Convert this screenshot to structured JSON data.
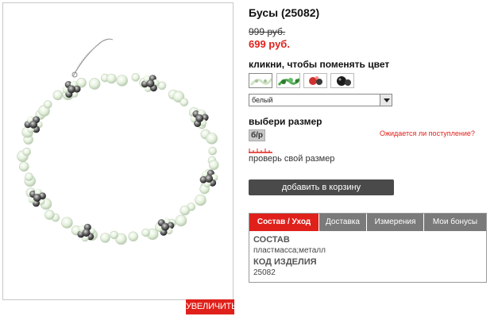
{
  "product": {
    "title": "Бусы (25082)",
    "old_price": "999 руб.",
    "new_price": "699 руб."
  },
  "gallery": {
    "zoom_label": "увеличить"
  },
  "color": {
    "heading": "кликни, чтобы поменять цвет",
    "swatches": [
      {
        "name": "white",
        "icon": "white-beads-swatch"
      },
      {
        "name": "green",
        "icon": "green-beads-swatch"
      },
      {
        "name": "red",
        "icon": "red-beads-swatch"
      },
      {
        "name": "black",
        "icon": "black-beads-swatch"
      }
    ],
    "selected_value": "белый"
  },
  "size": {
    "heading": "выбери размер",
    "option": "б/р",
    "stock_link": "Ожидается ли поступление?",
    "check_link": "проверь свой размер"
  },
  "cart": {
    "add_label": "добавить в корзину"
  },
  "tabs": {
    "items": [
      {
        "label": "Состав / Уход",
        "active": true
      },
      {
        "label": "Доставка",
        "active": false
      },
      {
        "label": "Измерения",
        "active": false
      },
      {
        "label": "Мои бонусы",
        "active": false
      }
    ],
    "content": {
      "composition_heading": "СОСТАВ",
      "composition_value": "пластмасса;металл",
      "code_heading": "КОД ИЗДЕЛИЯ",
      "code_value": "25082"
    }
  },
  "colors": {
    "accent_red": "#e0211b",
    "button_dark": "#4a4a4a",
    "tab_gray": "#7a7a7a"
  }
}
